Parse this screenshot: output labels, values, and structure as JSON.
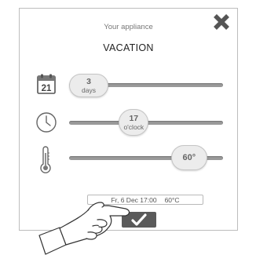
{
  "panel": {
    "subtitle": "Your appliance",
    "title": "VACATION"
  },
  "duration": {
    "value": "3",
    "unit": "days",
    "calendar_icon_text": "21",
    "level": 0.12
  },
  "time": {
    "value": "17",
    "unit": "o'clock",
    "level": 0.42
  },
  "temperature": {
    "value": "60°",
    "level": 0.78
  },
  "summary": {
    "datetime": "Fr, 6 Dec 17:00",
    "temperature": "60°C"
  },
  "icons": {
    "close": "close-x-icon",
    "calendar": "calendar-icon",
    "clock": "clock-icon",
    "thermometer": "thermometer-icon",
    "confirm": "checkmark-icon",
    "hand": "pointing-hand-icon"
  },
  "colors": {
    "track": "#9a9a9a",
    "knob": "#ececec",
    "confirm_button": "#5a5a5a",
    "close": "#555555"
  }
}
